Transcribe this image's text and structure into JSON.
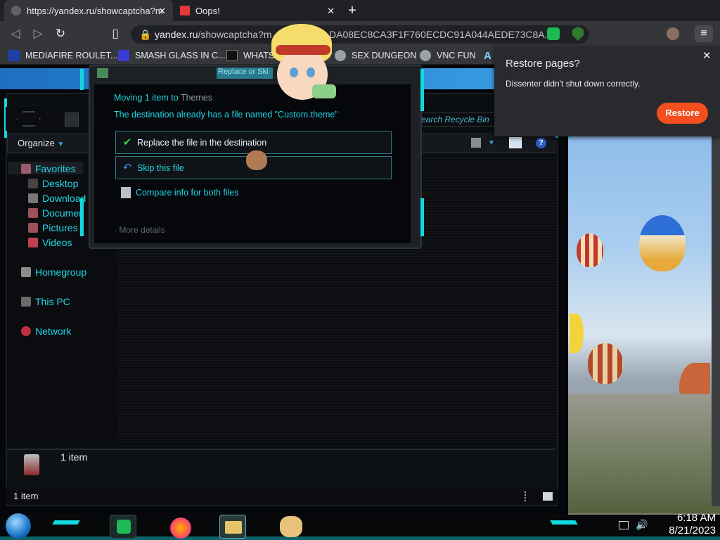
{
  "browser": {
    "tabs": [
      {
        "title": "https://yandex.ru/showcaptcha?m",
        "close": "✕"
      },
      {
        "title": "Oops!",
        "close": "✕"
      }
    ],
    "new_tab": "+",
    "address": {
      "host": "yandex.ru",
      "path": "/showcaptcha?m",
      "tail": "DA08EC8CA3F1F760ECDC91A044AEDE73C8A..."
    },
    "bookmarks": [
      "MEDIAFIRE ROULET...",
      "SMASH GLASS IN C...",
      "WHATS",
      "SEX DUNGEON",
      "VNC FUN",
      "A"
    ],
    "menu_icon": "≡",
    "colors": {
      "accent": "#14d8e0",
      "restore": "#f24e1e"
    }
  },
  "restore_popup": {
    "title": "Restore pages?",
    "message": "Dissenter didn't shut down correctly.",
    "button": "Restore",
    "close": "✕"
  },
  "explorer": {
    "organize": "Organize",
    "search_placeholder": "earch Recycle Bin",
    "nav": {
      "favorites": "Favorites",
      "desktop": "Desktop",
      "downloads": "Download",
      "documents": "Documen",
      "pictures": "Pictures",
      "videos": "Videos",
      "homegroup": "Homegroup",
      "this_pc": "This PC",
      "network": "Network"
    },
    "details_count": "1 item",
    "status": "1 item"
  },
  "dialog": {
    "hint": "Replace or Ski",
    "moving_prefix": "Moving 1 item to ",
    "moving_target": "Themes",
    "conflict": "The destination already has a file named \"Custom.theme\"",
    "option_replace": "Replace the file in the destination",
    "option_skip": "Skip this file",
    "option_compare": "Compare info for both files",
    "more_details": "More details"
  },
  "taskbar": {
    "time": "6:18 AM",
    "date": "8/21/2023"
  }
}
